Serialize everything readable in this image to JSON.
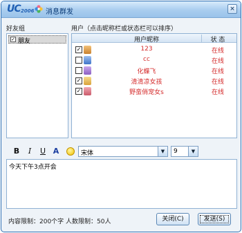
{
  "window": {
    "logo_text": "UC",
    "logo_year": "2006",
    "title": "消息群发",
    "close_label": "×"
  },
  "friends": {
    "label": "好友组",
    "groups": [
      {
        "name": "朋友",
        "checked": true
      }
    ]
  },
  "users": {
    "label": "用户（点击昵称栏或状态栏可以排序）",
    "headers": {
      "nickname": "用户昵称",
      "status": "状 态"
    },
    "rows": [
      {
        "nickname": "123",
        "status": "在线",
        "checked": true,
        "avatar_color": "#c9822f"
      },
      {
        "nickname": "cc",
        "status": "在线",
        "checked": false,
        "avatar_color": "#3f74c9"
      },
      {
        "nickname": "化蝶飞",
        "status": "在线",
        "checked": false,
        "avatar_color": "#8b5fc2"
      },
      {
        "nickname": "清清凉女孩",
        "status": "在线",
        "checked": true,
        "avatar_color": "#d9a23a"
      },
      {
        "nickname": "野蛮俏宠女s",
        "status": "在线",
        "checked": true,
        "avatar_color": "#c95a6a"
      }
    ],
    "name_color": "#d42a2a"
  },
  "toolbar": {
    "bold": "B",
    "italic": "I",
    "underline": "U",
    "color": "A",
    "font": "宋体",
    "size": "9"
  },
  "message": {
    "text": "今天下午3点开会"
  },
  "footer": {
    "limits": "内容限制：200个字  人数限制：50人",
    "close_button": "关闭(C)",
    "send_button": "发送(S)"
  }
}
